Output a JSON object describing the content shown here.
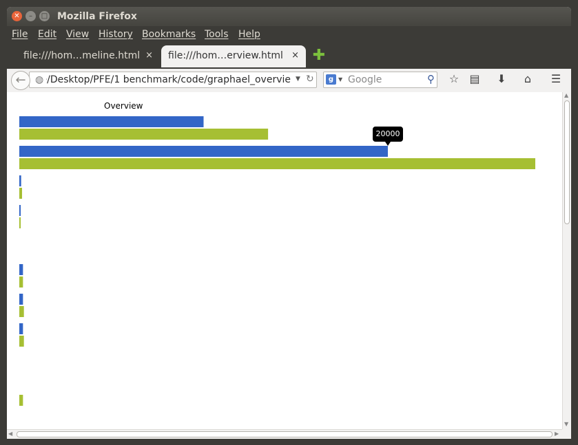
{
  "window": {
    "title": "Mozilla Firefox"
  },
  "menubar": {
    "items": [
      "File",
      "Edit",
      "View",
      "History",
      "Bookmarks",
      "Tools",
      "Help"
    ]
  },
  "tabs": [
    {
      "label": "file:///hom…meline.html",
      "close": "×"
    },
    {
      "label": "file:///hom…erview.html",
      "close": "×"
    }
  ],
  "navbar": {
    "url": "/home/Desktop/PFE/1 benchmark/code/graphael_overvie",
    "search_placeholder": "Google"
  },
  "colors": {
    "blue": "#3366c7",
    "green": "#a6bf33"
  },
  "chart_data": {
    "type": "bar",
    "orientation": "horizontal",
    "title": "Overview",
    "value_max": 28000,
    "tooltip": {
      "text": "20000",
      "series": 0,
      "group": 1
    },
    "series": [
      {
        "color": "blue",
        "values": [
          10000,
          20000,
          100,
          30,
          null,
          200,
          200,
          200,
          null,
          null
        ]
      },
      {
        "color": "green",
        "values": [
          13500,
          28000,
          150,
          60,
          null,
          200,
          250,
          250,
          null,
          200
        ]
      }
    ]
  }
}
